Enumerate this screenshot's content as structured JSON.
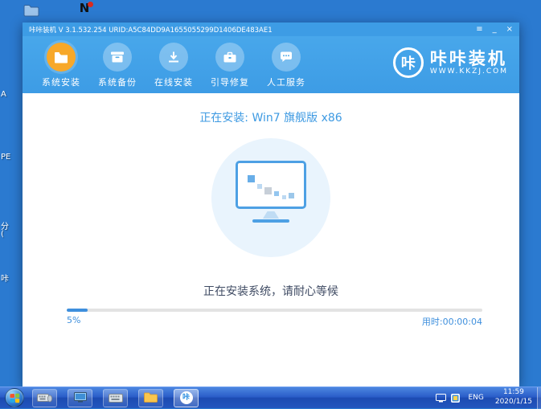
{
  "desktop": {
    "shortcut_n_label": "N",
    "left_label_fragments": [
      "A",
      "PE",
      "分",
      "(",
      "咔"
    ]
  },
  "window": {
    "title": "咔咔装机 V 3.1.532.254 URID:A5C84DD9A1655055299D1406DE483AE1",
    "controls": {
      "menu": "≡",
      "minimize": "_",
      "close": "×"
    },
    "nav": {
      "items": [
        {
          "label": "系统安装",
          "active": true
        },
        {
          "label": "系统备份",
          "active": false
        },
        {
          "label": "在线安装",
          "active": false
        },
        {
          "label": "引导修复",
          "active": false
        },
        {
          "label": "人工服务",
          "active": false
        }
      ],
      "logo": {
        "badge": "咔",
        "brand": "咔咔装机",
        "site": "WWW.KKZJ.COM"
      }
    },
    "main": {
      "installing_title": "正在安装: Win7 旗舰版 x86",
      "status_text": "正在安装系统，请耐心等候",
      "progress_percent_label": "5%",
      "progress_value": 5,
      "elapsed_label": "用时:00:00:04"
    }
  },
  "taskbar": {
    "app_badge": "咔",
    "tray": {
      "language": "ENG",
      "time": "11:59",
      "date": "2020/1/15"
    }
  },
  "colors": {
    "desktop": "#2b7ad0",
    "header": "#3d9ce5",
    "active_tab": "#f7a82a",
    "progress": "#3e8fdd"
  }
}
